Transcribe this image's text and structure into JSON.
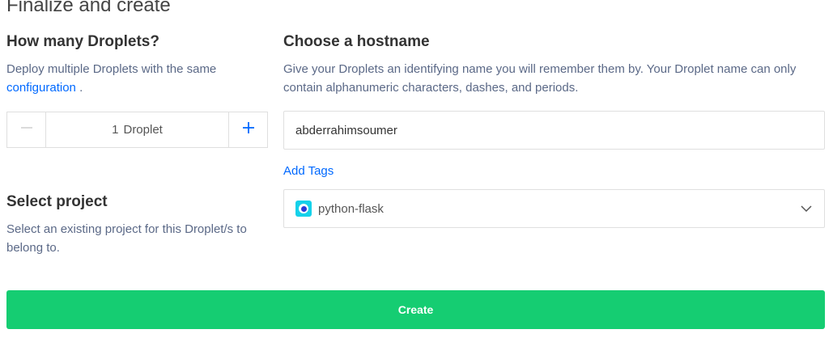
{
  "page": {
    "title": "Finalize and create"
  },
  "droplets": {
    "heading": "How many Droplets?",
    "description_prefix": "Deploy multiple Droplets with the same",
    "description_link": "configuration",
    "description_suffix": ".",
    "count": "1",
    "unit_label": "Droplet",
    "minus_icon": "minus-icon",
    "plus_icon": "plus-icon"
  },
  "hostname": {
    "heading": "Choose a hostname",
    "description": "Give your Droplets an identifying name you will remember them by. Your Droplet name can only contain alphanumeric characters, dashes, and periods.",
    "value": "abderrahimsoumer",
    "add_tags_label": "Add Tags"
  },
  "project": {
    "heading": "Select project",
    "description": "Select an existing project for this Droplet/s to belong to.",
    "selected": "python-flask",
    "icon": "project-icon",
    "icon_color": "#15d1ea"
  },
  "actions": {
    "create_label": "Create",
    "create_color": "#15cd72"
  },
  "colors": {
    "link": "#0069ff",
    "muted_text": "#5b6987"
  }
}
